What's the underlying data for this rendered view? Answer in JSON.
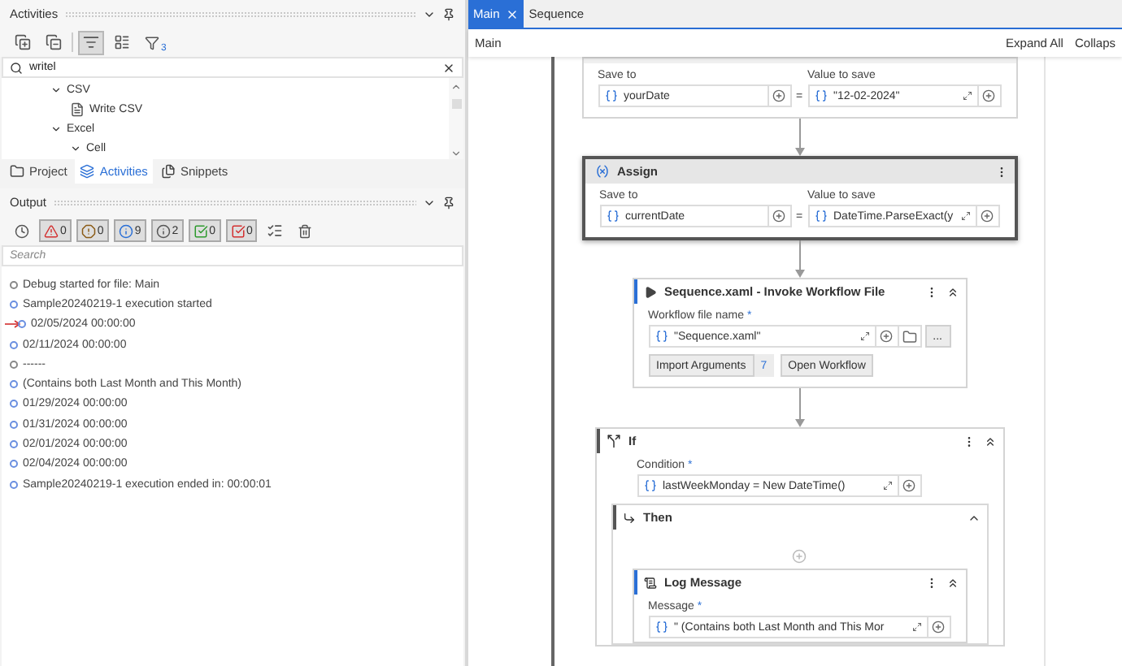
{
  "activities_panel": {
    "title": "Activities",
    "filter_count": "3",
    "search": {
      "value": "writel"
    },
    "tree": [
      {
        "label": "CSV",
        "expanded": true,
        "children": [
          {
            "label": "Write CSV"
          }
        ]
      },
      {
        "label": "Excel",
        "expanded": true,
        "children": [
          {
            "label": "Cell",
            "expanded": true
          }
        ]
      }
    ]
  },
  "panel_tabs": [
    {
      "label": "Project",
      "kind": "project",
      "selected": false
    },
    {
      "label": "Activities",
      "kind": "activities",
      "selected": true
    },
    {
      "label": "Snippets",
      "kind": "snippets",
      "selected": false
    }
  ],
  "output_panel": {
    "title": "Output",
    "filters": [
      {
        "kind": "error",
        "count": "0",
        "on": true
      },
      {
        "kind": "warning",
        "count": "0",
        "on": true
      },
      {
        "kind": "info",
        "count": "9",
        "on": true
      },
      {
        "kind": "trace",
        "count": "2",
        "on": true
      },
      {
        "kind": "success",
        "count": "0",
        "on": true
      },
      {
        "kind": "failure",
        "count": "0",
        "on": true
      }
    ],
    "search": {
      "placeholder": "Search"
    },
    "lines": [
      {
        "kind": "trace",
        "text": "Debug started for file: Main",
        "marked": false
      },
      {
        "kind": "info",
        "text": "Sample20240219-1 execution started",
        "marked": false
      },
      {
        "kind": "info",
        "text": "02/05/2024 00:00:00",
        "marked": true
      },
      {
        "kind": "info",
        "text": "02/11/2024 00:00:00",
        "marked": false
      },
      {
        "kind": "trace",
        "text": "------",
        "marked": false
      },
      {
        "kind": "info",
        "text": "(Contains both Last Month and This Month)",
        "marked": false
      },
      {
        "kind": "info",
        "text": "01/29/2024 00:00:00",
        "marked": false
      },
      {
        "kind": "info",
        "text": "01/31/2024 00:00:00",
        "marked": false
      },
      {
        "kind": "info",
        "text": "02/01/2024 00:00:00",
        "marked": false
      },
      {
        "kind": "info",
        "text": "02/04/2024 00:00:00",
        "marked": false
      },
      {
        "kind": "info",
        "text": "Sample20240219-1 execution ended in: 00:00:01",
        "marked": false
      }
    ]
  },
  "designer": {
    "tabs": [
      {
        "label": "Main",
        "selected": true,
        "closable": true
      },
      {
        "label": "Sequence",
        "selected": false,
        "closable": false
      }
    ],
    "breadcrumb": "Main",
    "actions": [
      "Expand All",
      "Collaps"
    ],
    "activities": [
      {
        "kind": "assign",
        "selected": false,
        "save_label": "Save to",
        "save_to": "yourDate",
        "operator": "=",
        "value_label": "Value to save",
        "value": "\"12-02-2024\""
      },
      {
        "kind": "assign",
        "selected": true,
        "title": "Assign",
        "save_label": "Save to",
        "save_to": "currentDate",
        "operator": "=",
        "value_label": "Value to save",
        "value": "DateTime.ParseExact(y"
      },
      {
        "kind": "invoke",
        "title": "Sequence.xaml - Invoke Workflow File",
        "field_label": "Workflow file name",
        "mark": "*",
        "value": "\"Sequence.xaml\"",
        "more": "...",
        "import_button": "Import Arguments",
        "arg_count": "7",
        "open_button": "Open Workflow"
      },
      {
        "kind": "if",
        "title": "If",
        "field_label": "Condition",
        "mark": "*",
        "value": "lastWeekMonday = New DateTime()",
        "then": {
          "title": "Then",
          "activities": [
            {
              "kind": "log",
              "title": "Log Message",
              "field_label": "Message",
              "mark": "*",
              "value": "\" (Contains both Last Month and This Mor"
            }
          ]
        }
      }
    ]
  }
}
